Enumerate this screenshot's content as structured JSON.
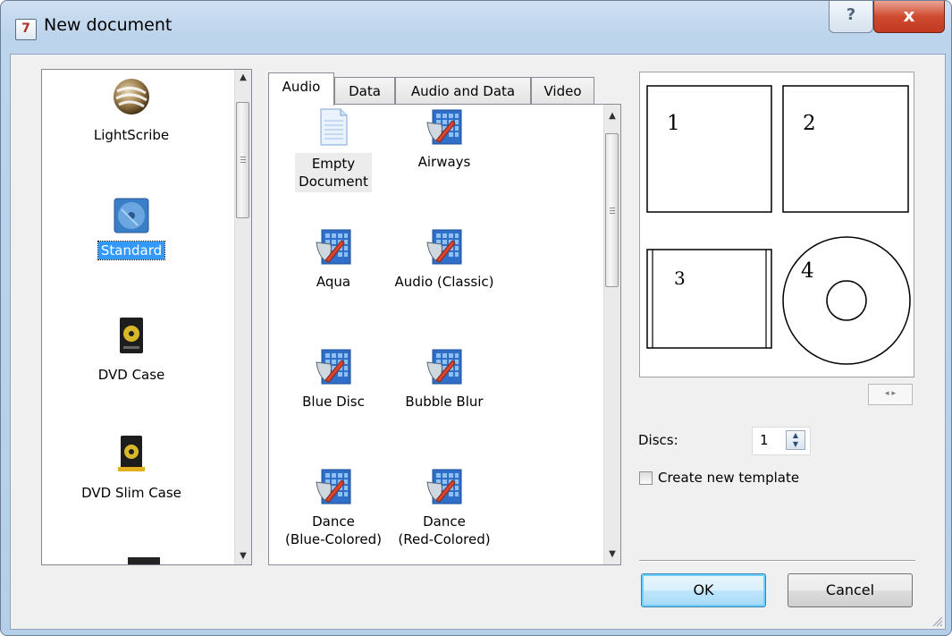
{
  "window": {
    "title": "New document",
    "help_label": "?",
    "close_label": "x",
    "icon_glyph": "7"
  },
  "type_list": {
    "items": [
      {
        "label": "LightScribe",
        "icon": "lightscribe-icon",
        "selected": false
      },
      {
        "label": "Standard",
        "icon": "standard-disc-icon",
        "selected": true
      },
      {
        "label": "DVD Case",
        "icon": "dvd-case-icon",
        "selected": false
      },
      {
        "label": "DVD Slim Case",
        "icon": "dvd-slim-case-icon",
        "selected": false
      }
    ]
  },
  "tabs": [
    {
      "label": "Audio",
      "active": true
    },
    {
      "label": "Data",
      "active": false
    },
    {
      "label": "Audio and Data",
      "active": false
    },
    {
      "label": "Video",
      "active": false
    }
  ],
  "templates": [
    {
      "line1": "Empty",
      "line2": "Document",
      "icon": "empty-document-icon"
    },
    {
      "line1": "Airways",
      "line2": "",
      "icon": "template-icon"
    },
    {
      "line1": "Aqua",
      "line2": "",
      "icon": "template-icon"
    },
    {
      "line1": "Audio (Classic)",
      "line2": "",
      "icon": "template-icon"
    },
    {
      "line1": "Blue Disc",
      "line2": "",
      "icon": "template-icon"
    },
    {
      "line1": "Bubble Blur",
      "line2": "",
      "icon": "template-icon"
    },
    {
      "line1": "Dance",
      "line2": "(Blue-Colored)",
      "icon": "template-icon"
    },
    {
      "line1": "Dance",
      "line2": "(Red-Colored)",
      "icon": "template-icon"
    }
  ],
  "preview": {
    "labels": [
      "1",
      "2",
      "3",
      "4"
    ],
    "pager_prev": "◂",
    "pager_next": "▸"
  },
  "discs": {
    "label": "Discs:",
    "value": "1"
  },
  "create_template": {
    "label": "Create new template",
    "checked": false
  },
  "buttons": {
    "ok": "OK",
    "cancel": "Cancel"
  },
  "colors": {
    "selection": "#3399ff",
    "titlebar": "#bcd4ec",
    "close": "#c13a22"
  }
}
